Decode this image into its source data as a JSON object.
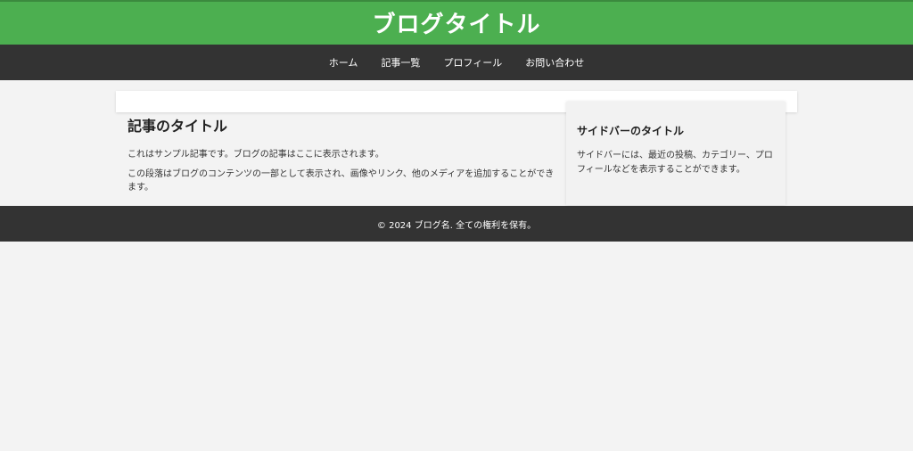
{
  "header": {
    "title": "ブログタイトル"
  },
  "nav": {
    "items": [
      {
        "label": "ホーム"
      },
      {
        "label": "記事一覧"
      },
      {
        "label": "プロフィール"
      },
      {
        "label": "お問い合わせ"
      }
    ]
  },
  "article": {
    "title": "記事のタイトル",
    "paragraphs": [
      "これはサンプル記事です。ブログの記事はここに表示されます。",
      "この段落はブログのコンテンツの一部として表示され、画像やリンク、他のメディアを追加することができます。"
    ]
  },
  "sidebar": {
    "title": "サイドバーのタイトル",
    "text": "サイドバーには、最近の投稿、カテゴリー、プロフィールなどを表示することができます。"
  },
  "footer": {
    "text": "© 2024 ブログ名. 全ての権利を保有。"
  },
  "colors": {
    "header_bg": "#4caf50",
    "nav_bg": "#333333",
    "footer_bg": "#333333",
    "page_bg": "#f3f3f3"
  }
}
